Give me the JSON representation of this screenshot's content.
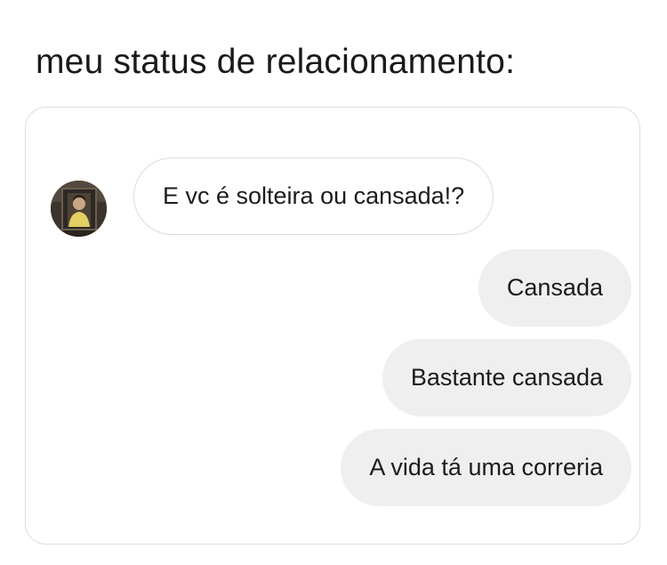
{
  "caption": "meu status de relacionamento:",
  "conversation": {
    "contact": {
      "avatar_icon": "profile-photo"
    },
    "incoming": [
      {
        "text": "E vc é solteira ou cansada!?"
      }
    ],
    "outgoing": [
      {
        "text": "Cansada"
      },
      {
        "text": "Bastante cansada"
      },
      {
        "text": "A vida tá uma correria"
      }
    ]
  },
  "colors": {
    "outgoing_bubble": "#efefef",
    "incoming_border": "#dcdcdc",
    "card_border": "#dddddd",
    "text": "#1c1c1c"
  }
}
